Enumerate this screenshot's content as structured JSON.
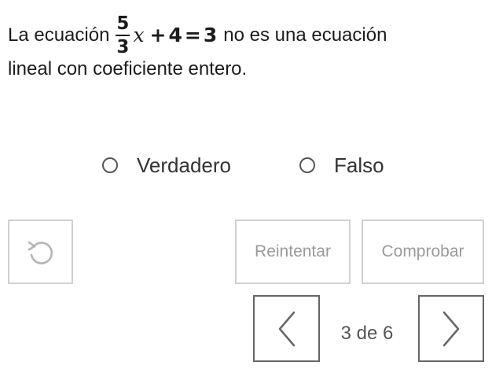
{
  "question": {
    "before": "La ecuación",
    "math": {
      "numerator": "5",
      "denominator": "3",
      "variable": "x",
      "op1": "+",
      "term": "4",
      "op2": "=",
      "result": "3"
    },
    "after": "no es una ecuación",
    "line2": "lineal con coeficiente entero."
  },
  "options": [
    {
      "label": "Verdadero",
      "selected": false
    },
    {
      "label": "Falso",
      "selected": false
    }
  ],
  "buttons": {
    "reset_icon": "undo-icon",
    "retry_label": "Reintentar",
    "check_label": "Comprobar"
  },
  "pagination": {
    "current": 3,
    "total": 6,
    "text": "3 de 6",
    "prev_icon": "chevron-left-icon",
    "next_icon": "chevron-right-icon"
  },
  "colors": {
    "text": "#1c1c1c",
    "disabled_text": "#9a9a9a",
    "button_border": "#d0d0d0",
    "nav_border": "#666666"
  }
}
